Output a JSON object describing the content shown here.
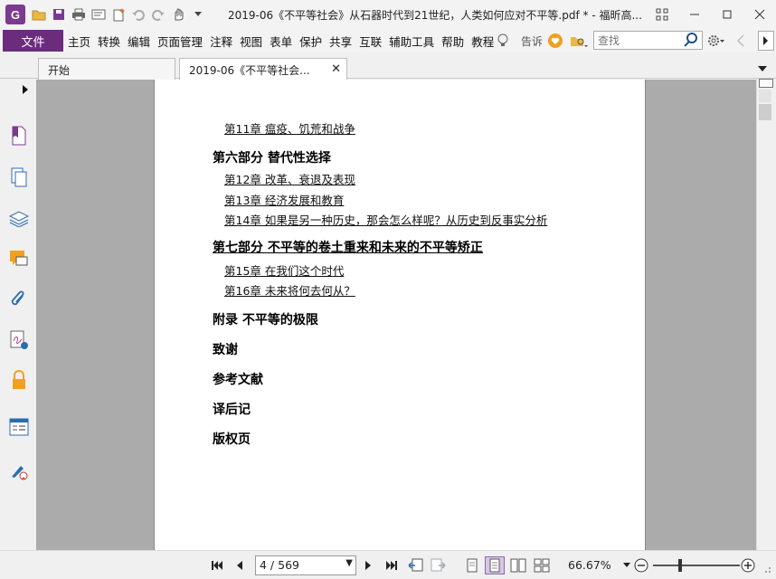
{
  "app": {
    "logo_letter": "G",
    "title": "2019-06《不平等社会》从石器时代到21世纪，人类如何应对不平等.pdf * - 福昕高..."
  },
  "menu": {
    "file": "文件",
    "items": [
      "主页",
      "转换",
      "编辑",
      "页面管理",
      "注释",
      "视图",
      "表单",
      "保护",
      "共享",
      "互联",
      "辅助工具",
      "帮助",
      "教程"
    ],
    "tell_me": "告诉",
    "search_placeholder": "查找"
  },
  "tabs": [
    {
      "label": "开始"
    },
    {
      "label": "2019-06《不平等社会..."
    }
  ],
  "toc": [
    {
      "kind": "sub",
      "text": "第11章 瘟疫、饥荒和战争"
    },
    {
      "kind": "part",
      "text": "第六部分 替代性选择"
    },
    {
      "kind": "sub",
      "text": "第12章 改革、衰退及表现"
    },
    {
      "kind": "sub",
      "text": "第13章 经济发展和教育"
    },
    {
      "kind": "sub",
      "text": "第14章 如果是另一种历史，那会怎么样呢？从历史到反事实分析"
    },
    {
      "kind": "part",
      "text": "第七部分 不平等的卷土重来和未来的不平等矫正"
    },
    {
      "kind": "sub",
      "text": "第15章 在我们这个时代"
    },
    {
      "kind": "sub",
      "text": "第16章 未来将何去何从？"
    },
    {
      "kind": "part",
      "text": "附录 不平等的极限"
    },
    {
      "kind": "part",
      "text": "致谢"
    },
    {
      "kind": "part",
      "text": "参考文献"
    },
    {
      "kind": "part",
      "text": "译后记"
    },
    {
      "kind": "part",
      "text": "版权页"
    }
  ],
  "status": {
    "page_indicator": "4 / 569",
    "zoom": "66.67%"
  },
  "colors": {
    "brand": "#6b2c7e",
    "doc_background": "#ababab"
  }
}
